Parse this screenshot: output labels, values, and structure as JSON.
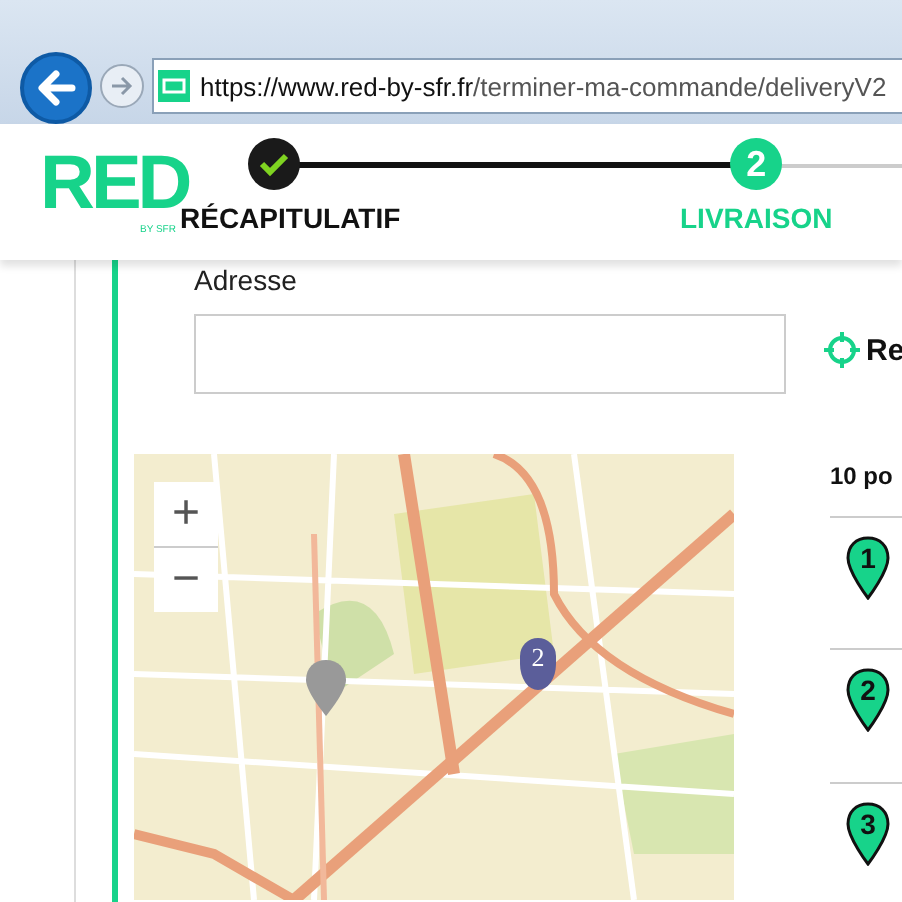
{
  "browser": {
    "url_host": "https://www.red-by-sfr.fr",
    "url_path": "/terminer-ma-commande/deliveryV2"
  },
  "logo": {
    "text": "RED",
    "tagline": "BY SFR"
  },
  "steps": [
    {
      "label": "RÉCAPITULATIF",
      "done": true,
      "selected": false
    },
    {
      "label": "LIVRAISON",
      "number": "2",
      "done": false,
      "selected": true
    }
  ],
  "address": {
    "label": "Adresse"
  },
  "locate_button": {
    "label": "Re"
  },
  "map": {
    "zoom_in": "+",
    "zoom_out": "−",
    "markers": [
      {
        "kind": "numbered",
        "label": "2"
      },
      {
        "kind": "plain"
      }
    ]
  },
  "results": {
    "title": "10 po",
    "items": [
      {
        "number": "1"
      },
      {
        "number": "2"
      },
      {
        "number": "3"
      }
    ]
  }
}
